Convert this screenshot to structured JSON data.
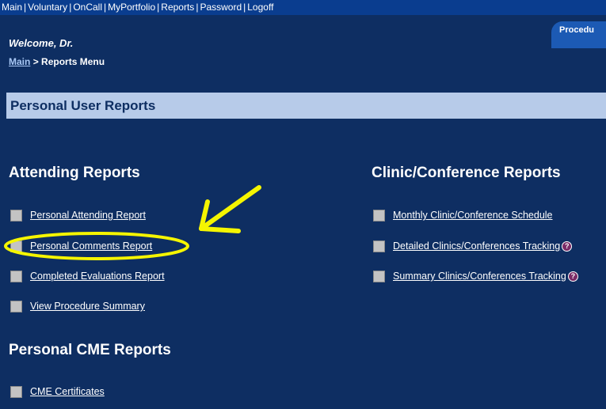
{
  "topnav": {
    "items": [
      "Main",
      "Voluntary",
      "OnCall",
      "MyPortfolio",
      "Reports",
      "Password",
      "Logoff"
    ],
    "separator": "|"
  },
  "procedure_tab": {
    "label": "Procedu"
  },
  "welcome": "Welcome, Dr.",
  "breadcrumb": {
    "link": "Main",
    "separator": ">",
    "current": "Reports Menu"
  },
  "section_title": "Personal User Reports",
  "attending": {
    "heading": "Attending Reports",
    "items": [
      "Personal Attending Report",
      "Personal Comments Report",
      "Completed Evaluations Report",
      "View Procedure Summary"
    ]
  },
  "clinic": {
    "heading": "Clinic/Conference Reports",
    "items": [
      "Monthly Clinic/Conference Schedule",
      "Detailed Clinics/Conferences Tracking",
      "Summary Clinics/Conferences Tracking"
    ],
    "help_icon": "?"
  },
  "cme": {
    "heading": "Personal CME Reports",
    "items": [
      "CME Certificates"
    ]
  },
  "colors": {
    "background": "#0e2e62",
    "nav_bar": "#0a3d8f",
    "section_bar": "#b7cbe9",
    "annotation": "#f5f500"
  },
  "icons": [
    "help-icon",
    "checkbox-icon",
    "arrow-annotation"
  ]
}
